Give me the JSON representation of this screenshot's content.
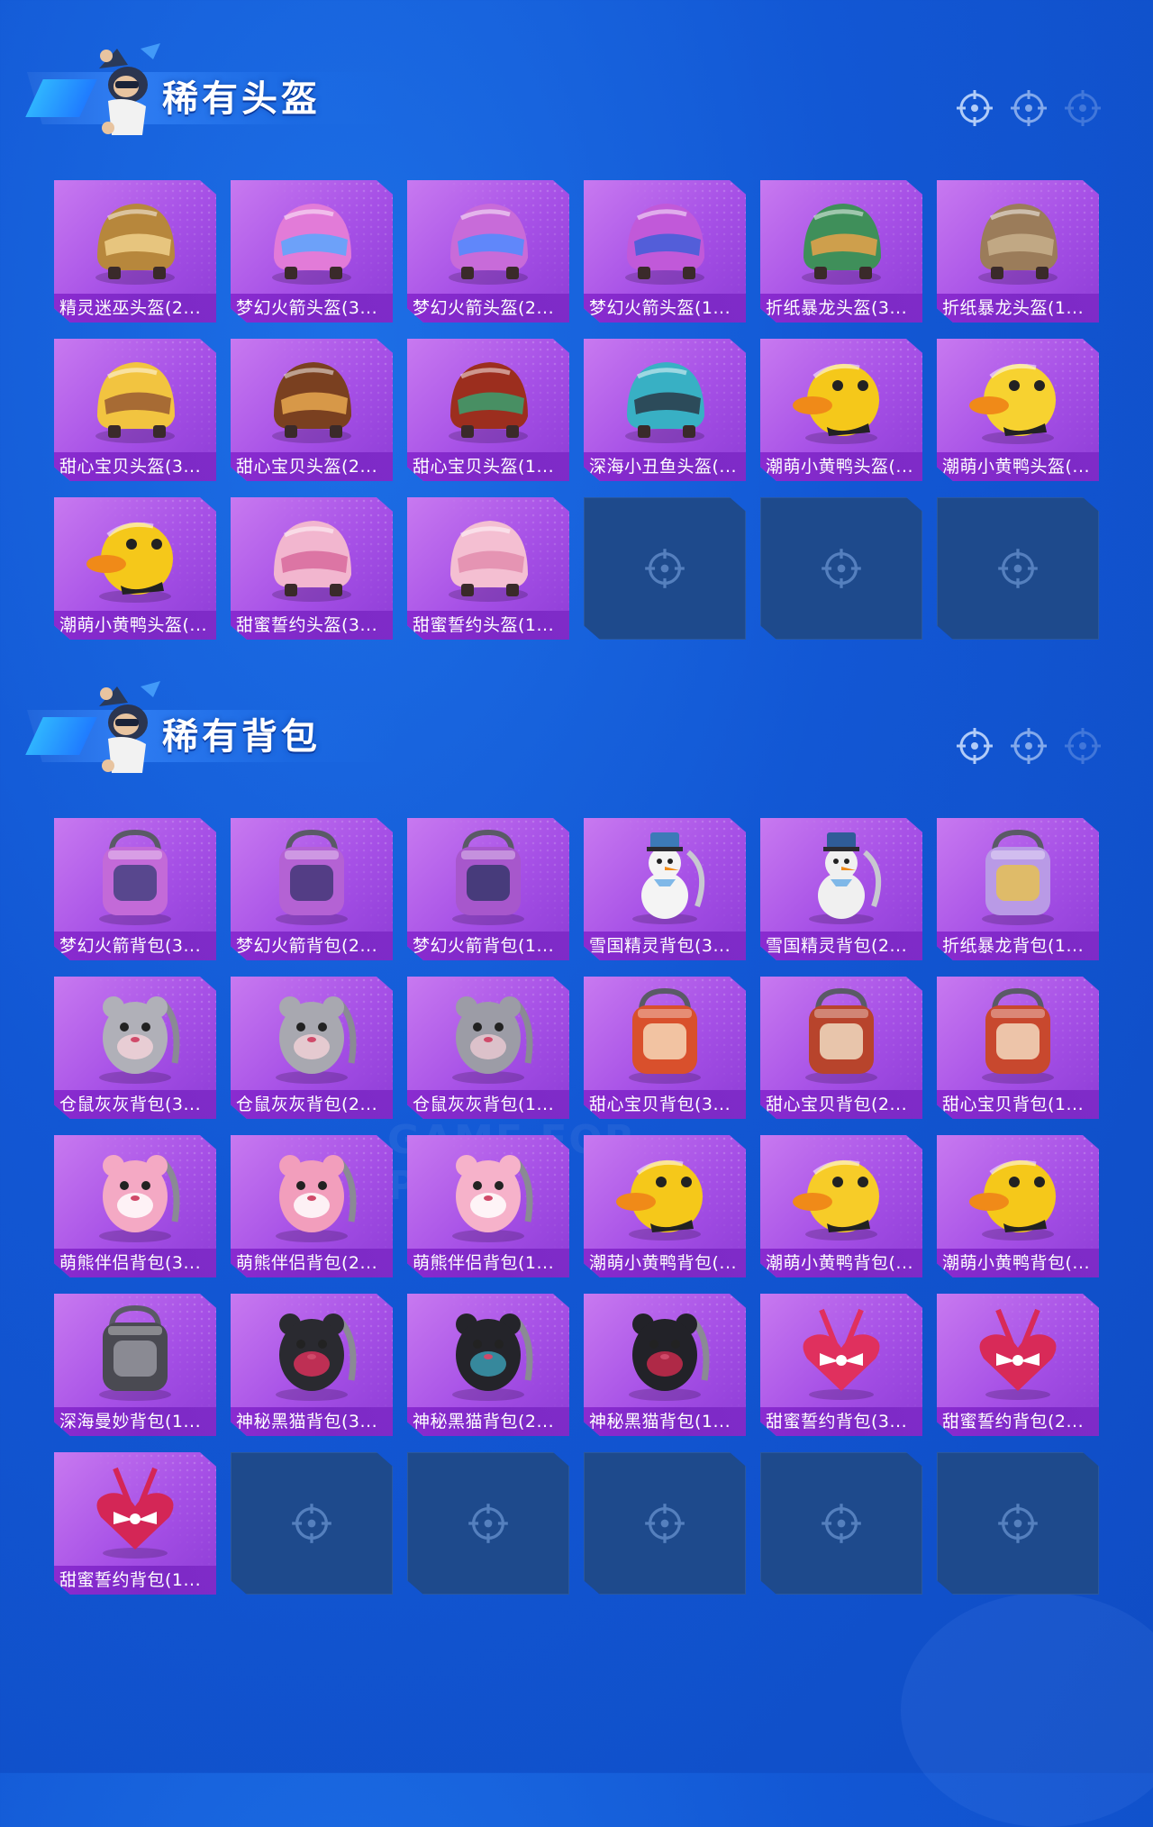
{
  "colors": {
    "background": "#1257d4",
    "card_fill": "#a650e6",
    "label_bg": "#8a2bd0",
    "empty_slot": "#1e4a8c"
  },
  "watermark": "GAME FOR PEACE",
  "sections": [
    {
      "title": "稀有头盔",
      "items": [
        {
          "label": "精灵迷巫头盔(2...",
          "icon": "wing-helmet-icon",
          "art": "helmet",
          "c1": "#b7873c",
          "c2": "#f0d08a"
        },
        {
          "label": "梦幻火箭头盔(3...",
          "icon": "rocket-helmet-icon",
          "art": "helmet",
          "c1": "#e27bd8",
          "c2": "#58a8ff"
        },
        {
          "label": "梦幻火箭头盔(2...",
          "icon": "rocket-helmet-icon",
          "art": "helmet",
          "c1": "#c86bd9",
          "c2": "#4e8cff"
        },
        {
          "label": "梦幻火箭头盔(1...",
          "icon": "rocket-helmet-icon",
          "art": "helmet",
          "c1": "#c159d9",
          "c2": "#3f5fd8"
        },
        {
          "label": "折纸暴龙头盔(3...",
          "icon": "dino-helmet-icon",
          "art": "helmet",
          "c1": "#3f8f5a",
          "c2": "#e8a24a"
        },
        {
          "label": "折纸暴龙头盔(1...",
          "icon": "dino-helmet-icon",
          "art": "helmet",
          "c1": "#9b7c5a",
          "c2": "#c8b08c"
        },
        {
          "label": "甜心宝贝头盔(3...",
          "icon": "cupcake-helmet-icon",
          "art": "helmet",
          "c1": "#f2c440",
          "c2": "#9a5c32"
        },
        {
          "label": "甜心宝贝头盔(2...",
          "icon": "cupcake-helmet-icon",
          "art": "helmet",
          "c1": "#7a4020",
          "c2": "#e8a850"
        },
        {
          "label": "甜心宝贝头盔(1...",
          "icon": "cupcake-helmet-icon",
          "art": "helmet",
          "c1": "#9c2e1e",
          "c2": "#3aa070"
        },
        {
          "label": "深海小丑鱼头盔(...",
          "icon": "clownfish-helmet-icon",
          "art": "helmet",
          "c1": "#38b0c4",
          "c2": "#2a3a48"
        },
        {
          "label": "潮萌小黄鸭头盔(...",
          "icon": "duck-helmet-icon",
          "art": "duck",
          "c1": "#f5c81a",
          "c2": "#f08a18"
        },
        {
          "label": "潮萌小黄鸭头盔(...",
          "icon": "duck-helmet-icon",
          "art": "duck",
          "c1": "#f7d230",
          "c2": "#f08a18"
        },
        {
          "label": "潮萌小黄鸭头盔(...",
          "icon": "duck-helmet-icon",
          "art": "duck",
          "c1": "#f5c81a",
          "c2": "#f08a18"
        },
        {
          "label": "甜蜜誓约头盔(3...",
          "icon": "sweet-vow-helmet-icon",
          "art": "helmet",
          "c1": "#f2b6cf",
          "c2": "#d86a9c"
        },
        {
          "label": "甜蜜誓约头盔(1...",
          "icon": "sweet-vow-helmet-icon",
          "art": "helmet",
          "c1": "#f4bfd2",
          "c2": "#e28cae"
        },
        null,
        null,
        null
      ]
    },
    {
      "title": "稀有背包",
      "items": [
        {
          "label": "梦幻火箭背包(3...",
          "icon": "rocket-backpack-icon",
          "art": "backpack",
          "c1": "#c36ad8",
          "c2": "#3d3f7c"
        },
        {
          "label": "梦幻火箭背包(2...",
          "icon": "rocket-backpack-icon",
          "art": "backpack",
          "c1": "#b462d4",
          "c2": "#3b3470"
        },
        {
          "label": "梦幻火箭背包(1...",
          "icon": "rocket-backpack-icon",
          "art": "backpack",
          "c1": "#a757cc",
          "c2": "#2f3566"
        },
        {
          "label": "雪国精灵背包(3...",
          "icon": "snowman-backpack-icon",
          "art": "snowman",
          "c1": "#f4f4f4",
          "c2": "#3c7ab8"
        },
        {
          "label": "雪国精灵背包(2...",
          "icon": "snowman-backpack-icon",
          "art": "snowman",
          "c1": "#f0f0f0",
          "c2": "#2f5c98"
        },
        {
          "label": "折纸暴龙背包(1...",
          "icon": "dino-backpack-icon",
          "art": "backpack",
          "c1": "#b99ae6",
          "c2": "#e8c34a"
        },
        {
          "label": "仓鼠灰灰背包(3...",
          "icon": "hamster-backpack-icon",
          "art": "animal",
          "c1": "#b0b0b8",
          "c2": "#f2d2d8"
        },
        {
          "label": "仓鼠灰灰背包(2...",
          "icon": "hamster-backpack-icon",
          "art": "animal",
          "c1": "#a8a8b0",
          "c2": "#f0d0d6"
        },
        {
          "label": "仓鼠灰灰背包(1...",
          "icon": "hamster-backpack-icon",
          "art": "animal",
          "c1": "#9c9ca6",
          "c2": "#e8c8d0"
        },
        {
          "label": "甜心宝贝背包(3...",
          "icon": "cupcake-backpack-icon",
          "art": "backpack",
          "c1": "#d9502c",
          "c2": "#f7e0c0"
        },
        {
          "label": "甜心宝贝背包(2...",
          "icon": "cupcake-backpack-icon",
          "art": "backpack",
          "c1": "#b8442c",
          "c2": "#f4e6cc"
        },
        {
          "label": "甜心宝贝背包(1...",
          "icon": "cupcake-backpack-icon",
          "art": "backpack",
          "c1": "#c8482e",
          "c2": "#f6e4c8"
        },
        {
          "label": "萌熊伴侣背包(3...",
          "icon": "bear-backpack-icon",
          "art": "animal",
          "c1": "#f4a9c4",
          "c2": "#ffffff"
        },
        {
          "label": "萌熊伴侣背包(2...",
          "icon": "bear-backpack-icon",
          "art": "animal",
          "c1": "#f29ebc",
          "c2": "#ffffff"
        },
        {
          "label": "萌熊伴侣背包(1...",
          "icon": "bear-backpack-icon",
          "art": "animal",
          "c1": "#f6b2ca",
          "c2": "#ffffff"
        },
        {
          "label": "潮萌小黄鸭背包(...",
          "icon": "duck-backpack-icon",
          "art": "duck",
          "c1": "#f5c81a",
          "c2": "#f08a18"
        },
        {
          "label": "潮萌小黄鸭背包(...",
          "icon": "duck-backpack-icon",
          "art": "duck",
          "c1": "#f7cc28",
          "c2": "#f08a18"
        },
        {
          "label": "潮萌小黄鸭背包(...",
          "icon": "duck-backpack-icon",
          "art": "duck",
          "c1": "#f5c81a",
          "c2": "#f08a18"
        },
        {
          "label": "深海曼妙背包(1...",
          "icon": "canister-backpack-icon",
          "art": "backpack",
          "c1": "#4a4a52",
          "c2": "#9a9aa4"
        },
        {
          "label": "神秘黑猫背包(3...",
          "icon": "black-cat-backpack-icon",
          "art": "animal",
          "c1": "#2a2a30",
          "c2": "#d8305a"
        },
        {
          "label": "神秘黑猫背包(2...",
          "icon": "black-cat-backpack-icon",
          "art": "animal",
          "c1": "#24242a",
          "c2": "#3a9ab0"
        },
        {
          "label": "神秘黑猫背包(1...",
          "icon": "black-cat-backpack-icon",
          "art": "animal",
          "c1": "#222228",
          "c2": "#c82a4c"
        },
        {
          "label": "甜蜜誓约背包(3...",
          "icon": "heart-backpack-icon",
          "art": "heart",
          "c1": "#e0305e",
          "c2": "#ffffff"
        },
        {
          "label": "甜蜜誓约背包(2...",
          "icon": "heart-backpack-icon",
          "art": "heart",
          "c1": "#d82a58",
          "c2": "#ffffff"
        },
        {
          "label": "甜蜜誓约背包(1...",
          "icon": "heart-backpack-icon",
          "art": "heart",
          "c1": "#d42656",
          "c2": "#ffffff"
        },
        null,
        null,
        null,
        null,
        null
      ]
    }
  ]
}
